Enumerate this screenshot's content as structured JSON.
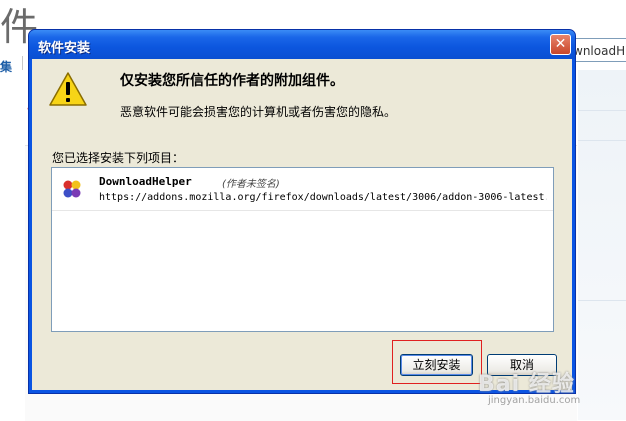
{
  "background": {
    "page_title_char": "件",
    "link_text": "集",
    "search_value": "wnloadH"
  },
  "dialog": {
    "title": "软件安装",
    "close_glyph": "✕",
    "heading": "仅安装您所信任的作者的附加组件。",
    "subtext": "恶意软件可能会损害您的计算机或者伤害您的隐私。",
    "list_label": "您已选择安装下列项目：",
    "items": [
      {
        "name": "DownloadHelper",
        "note": "(作者未签名)",
        "url": "https://addons.mozilla.org/firefox/downloads/latest/3006/addon-3006-latest.",
        "icon": "addon-puzzle-icon"
      }
    ],
    "buttons": {
      "install": "立刻安装",
      "cancel": "取消"
    },
    "icons": {
      "warning": "warning-triangle-icon"
    }
  },
  "watermark": {
    "text": "Bai 经验",
    "sub": "jingyan.baidu.com"
  },
  "colors": {
    "titlebar": "#0a54e3",
    "client_bg": "#ece9d8",
    "highlight": "#e02020"
  }
}
